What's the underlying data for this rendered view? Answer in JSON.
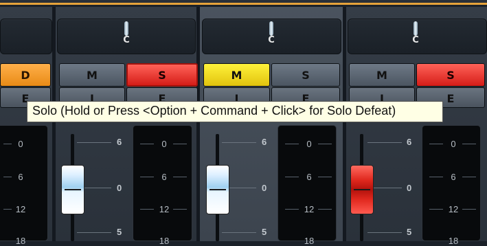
{
  "channels": [
    {
      "pan_label": "C",
      "mute_label": "M",
      "solo_label": "S",
      "mute_state": "off",
      "solo_state": "on"
    },
    {
      "pan_label": "C",
      "mute_label": "M",
      "solo_label": "S",
      "mute_state": "on",
      "solo_state": "off"
    },
    {
      "pan_label": "C",
      "mute_label": "M",
      "solo_label": "S",
      "mute_state": "off",
      "solo_state": "on"
    }
  ],
  "left_partial": {
    "button_label": "D",
    "button2_label": "E"
  },
  "row2_labels": [
    "I",
    "E",
    "I",
    "E",
    "I",
    "E"
  ],
  "tooltip": {
    "text": "Solo (Hold or Press <Option + Command + Click> for Solo Defeat)"
  },
  "meter_scale": [
    "0",
    "6",
    "12",
    "18"
  ],
  "fader_scale": [
    "6",
    "0",
    "5"
  ],
  "colors": {
    "accent_line": "#e6a33a",
    "solo_on": "#e8302a",
    "mute_on": "#f0dc20",
    "fader_red": "#d82018"
  }
}
